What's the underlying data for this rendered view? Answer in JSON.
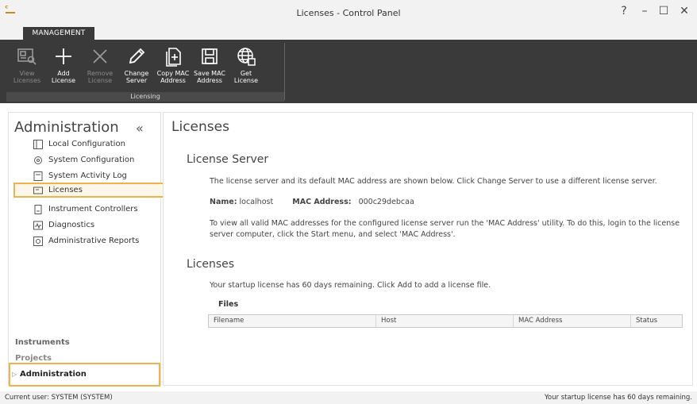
{
  "window": {
    "title": "Licenses - Control Panel",
    "help": "?",
    "minimize": "–",
    "maximize": "☐",
    "close": "✕"
  },
  "tabs": [
    {
      "label": "MANAGEMENT"
    }
  ],
  "ribbon": {
    "group_label": "Licensing",
    "buttons": [
      {
        "label": "View\nLicenses",
        "icon": "view-licenses-icon",
        "enabled": false
      },
      {
        "label": "Add\nLicense",
        "icon": "plus-icon",
        "enabled": true
      },
      {
        "label": "Remove\nLicense",
        "icon": "x-icon",
        "enabled": false
      },
      {
        "label": "Change\nServer",
        "icon": "pencil-icon",
        "enabled": true
      },
      {
        "label": "Copy MAC\nAddress",
        "icon": "copy-icon",
        "enabled": true
      },
      {
        "label": "Save MAC\nAddress",
        "icon": "save-icon",
        "enabled": true
      },
      {
        "label": "Get\nLicense",
        "icon": "globe-icon",
        "enabled": true
      }
    ]
  },
  "sidebar": {
    "title": "Administration",
    "collapse": "«",
    "items": [
      {
        "label": "Local Configuration",
        "icon": "local-config-icon"
      },
      {
        "label": "System Configuration",
        "icon": "system-config-icon"
      },
      {
        "label": "System Activity Log",
        "icon": "log-icon"
      },
      {
        "label": "Licenses",
        "icon": "licenses-icon",
        "active": true
      },
      {
        "label": "Instrument Controllers",
        "icon": "instrument-controller-icon"
      },
      {
        "label": "Diagnostics",
        "icon": "diagnostics-icon"
      },
      {
        "label": "Administrative Reports",
        "icon": "reports-icon"
      }
    ],
    "sections": [
      {
        "label": "Instruments"
      },
      {
        "label": "Projects"
      },
      {
        "label": "Administration",
        "active": true
      }
    ]
  },
  "content": {
    "title": "Licenses",
    "license_server": {
      "heading": "License Server",
      "description": "The license server and its default MAC address are shown below. Click Change Server to use a different license server.",
      "name_label": "Name:",
      "name_value": "localhost",
      "mac_label": "MAC Address:",
      "mac_value": "000c29debcaa",
      "mac_hint": "To view all valid MAC addresses for the configured license server run the 'MAC Address' utility.  To do this, login to the license server computer, click the Start menu, and select 'MAC Address'."
    },
    "licenses": {
      "heading": "Licenses",
      "startup_message": "Your startup license has 60 days remaining. Click Add to add a license file.",
      "files_label": "Files",
      "columns": [
        "Filename",
        "Host",
        "MAC Address",
        "Status"
      ]
    }
  },
  "statusbar": {
    "user": "Current user: SYSTEM (SYSTEM)",
    "license_status": "Your startup license has 60 days remaining."
  }
}
